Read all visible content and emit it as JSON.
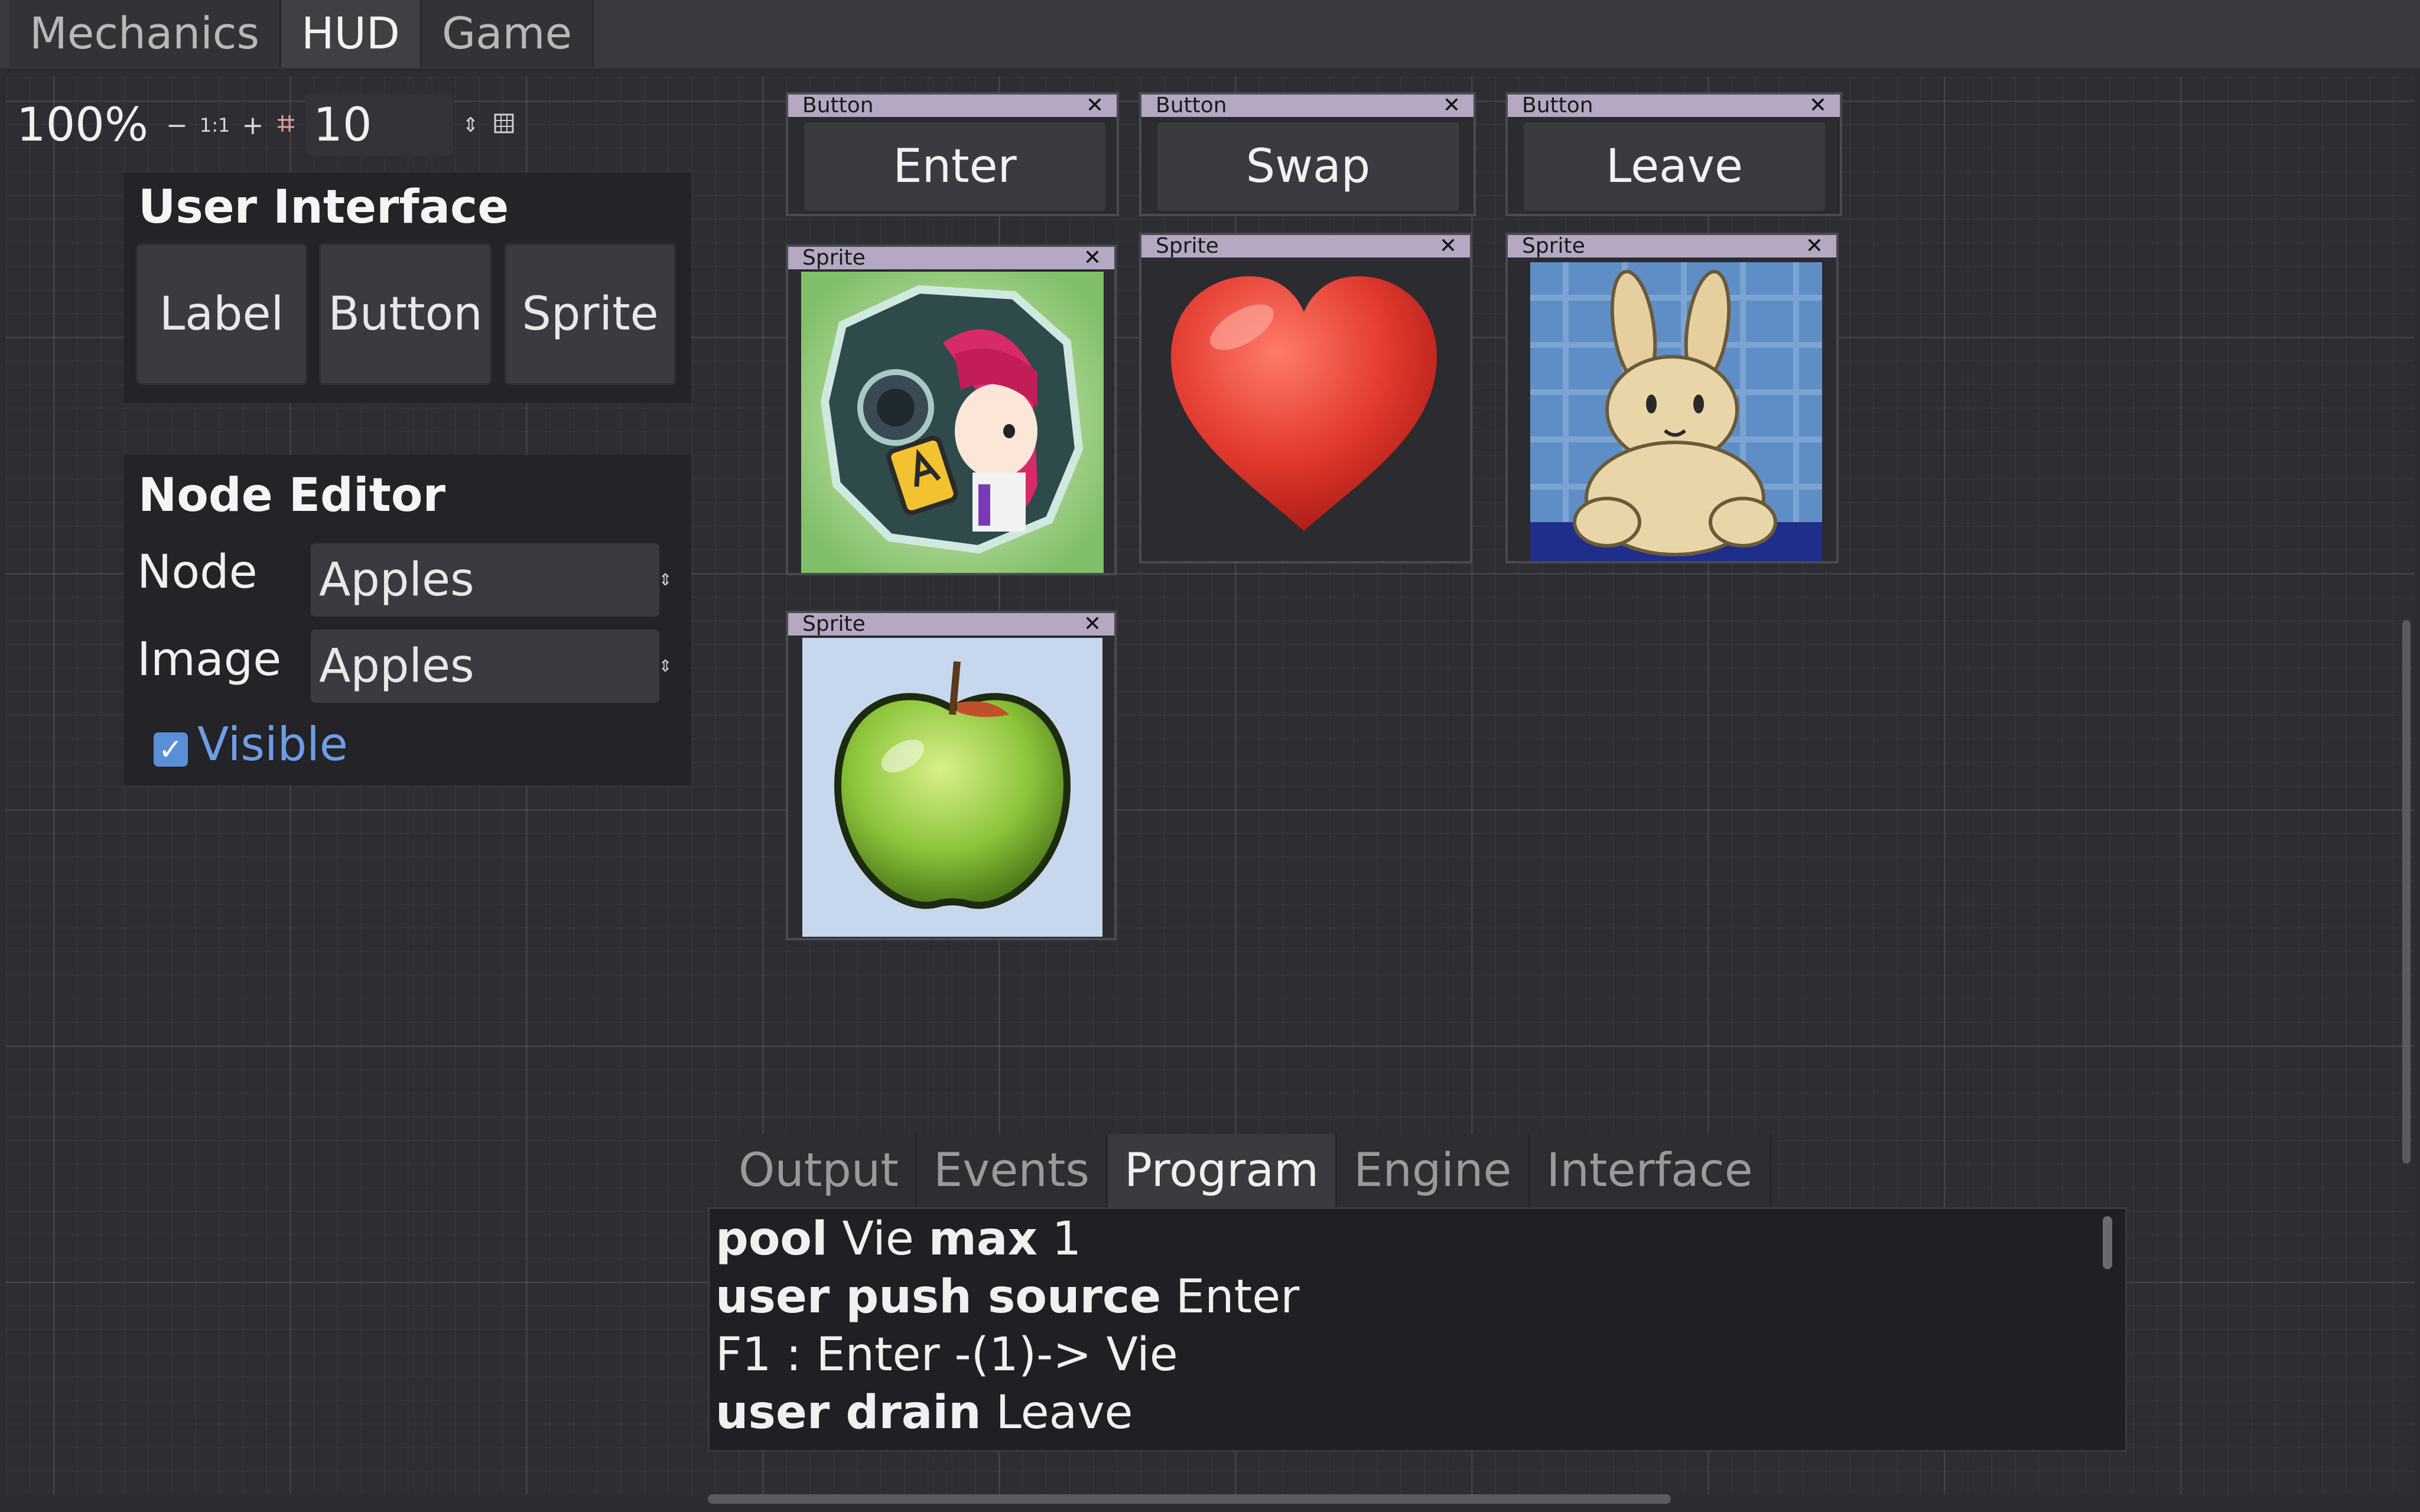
{
  "main_tabs": [
    {
      "label": "Mechanics",
      "active": false
    },
    {
      "label": "HUD",
      "active": true
    },
    {
      "label": "Game",
      "active": false
    }
  ],
  "zoom": {
    "percent": "100%",
    "minus": "−",
    "reset": "1:1",
    "plus": "+",
    "snap_icon": "snap-icon",
    "snap_value": "10",
    "spin": "⇕",
    "grid_icon": "grid-icon"
  },
  "user_interface": {
    "title": "User Interface",
    "buttons": [
      "Label",
      "Button",
      "Sprite"
    ]
  },
  "node_editor": {
    "title": "Node Editor",
    "node_label": "Node",
    "node_value": "Apples",
    "image_label": "Image",
    "image_value": "Apples",
    "visible_label": "Visible",
    "visible_checked": true
  },
  "graph_nodes": {
    "button_enter": {
      "header": "Button",
      "label": "Enter"
    },
    "button_swap": {
      "header": "Button",
      "label": "Swap"
    },
    "button_leave": {
      "header": "Button",
      "label": "Leave"
    },
    "sprite_character": {
      "header": "Sprite",
      "image": "character-illustration"
    },
    "sprite_heart": {
      "header": "Sprite",
      "image": "heart-illustration"
    },
    "sprite_rabbit": {
      "header": "Sprite",
      "image": "rabbit-illustration"
    },
    "sprite_apple": {
      "header": "Sprite",
      "image": "apple-illustration"
    },
    "close": "✕"
  },
  "bottom_tabs": [
    {
      "label": "Output",
      "active": false
    },
    {
      "label": "Events",
      "active": false
    },
    {
      "label": "Program",
      "active": true
    },
    {
      "label": "Engine",
      "active": false
    },
    {
      "label": "Interface",
      "active": false
    }
  ],
  "console": {
    "line1_kw1": "pool",
    "line1_t1": " Vie ",
    "line1_kw2": "max",
    "line1_t2": " 1",
    "line2_kw": "user push source",
    "line2_t": " Enter",
    "line3": "F1 : Enter -(1)-> Vie",
    "line4_kw": "user drain",
    "line4_t": " Leave"
  },
  "colors": {
    "accent_checkbox": "#5a8fd8",
    "node_header": "#b4a8c2",
    "background": "#2c2c33"
  }
}
